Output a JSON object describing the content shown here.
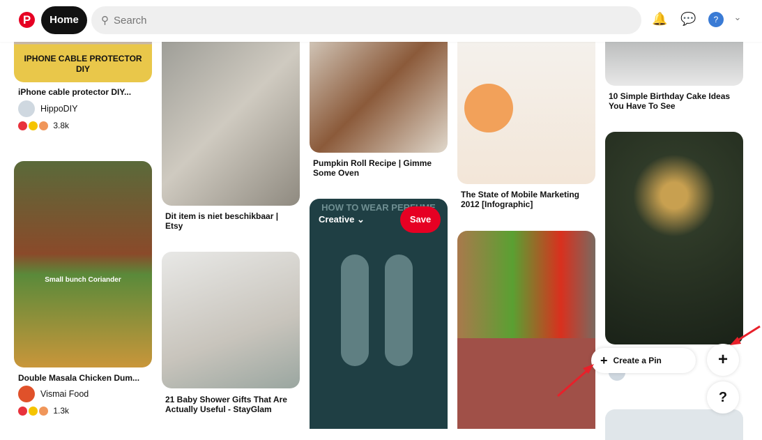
{
  "header": {
    "logo": "P",
    "home_label": "Home",
    "search_placeholder": "Search",
    "icons": [
      "bell-icon",
      "chat-icon",
      "avatar",
      "chevron-down-icon"
    ]
  },
  "pins": [
    {
      "title": "iPhone cable protector DIY...",
      "image_text": "IPHONE CABLE PROTECTOR DIY",
      "user": "HippoDIY",
      "reactions": "3.8k"
    },
    {
      "title": "Double Masala Chicken Dum...",
      "image_text": "Small bunch Coriander",
      "user": "Vismai Food",
      "reactions": "1.3k"
    },
    {
      "title": "Dit item is niet beschikbaar | Etsy"
    },
    {
      "title": "21 Baby Shower Gifts That Are Actually Useful - StayGlam"
    },
    {
      "title": "Pumpkin Roll Recipe | Gimme Some Oven"
    },
    {
      "title": "",
      "image_text": "HOW TO WEAR PERFUME",
      "board_select": "Creative",
      "save_label": "Save"
    },
    {
      "title": "The State of Mobile Marketing 2012 [Infographic]"
    },
    {
      "title": ""
    },
    {
      "title": "10 Simple Birthday Cake Ideas You Have To See"
    }
  ],
  "floating": {
    "create_pin_label": "Create a Pin",
    "plus": "+",
    "help": "?"
  },
  "colors": {
    "brand": "#e60023",
    "annotation_arrow": "#e8202a"
  }
}
